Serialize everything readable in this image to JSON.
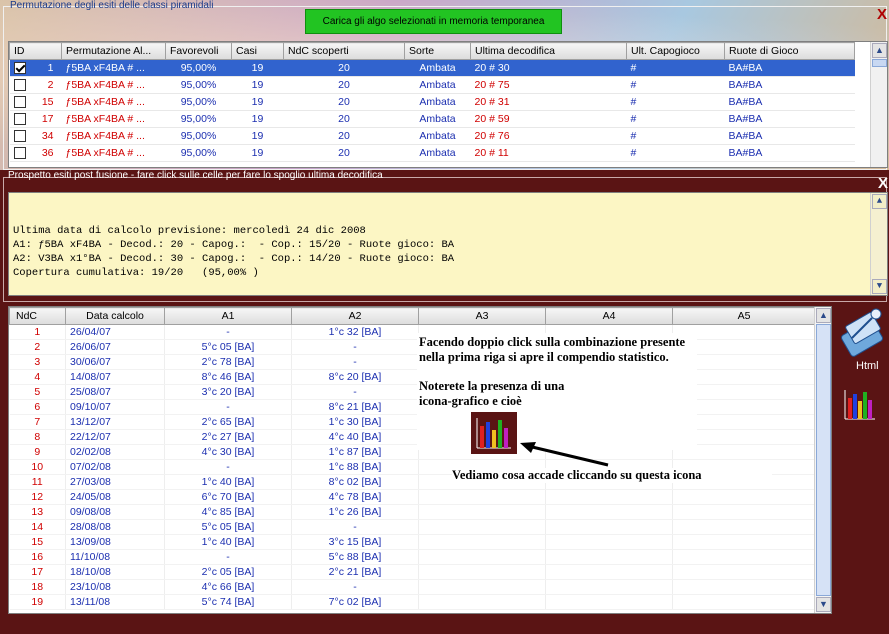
{
  "top_panel": {
    "group_title": "Permutazione degli esiti delle classi piramidali",
    "close_label": "X",
    "load_button_label": "Carica gli algo selezionati in memoria temporanea",
    "columns": [
      "ID",
      "Permutazione Al...",
      "Favorevoli",
      "Casi",
      "NdC scoperti",
      "Sorte",
      "Ultima decodifica",
      "Ult. Capogioco",
      "Ruote di Gioco"
    ],
    "rows": [
      {
        "checked": true,
        "id": "1",
        "perm": "ƒ5BA xF4BA # ...",
        "fav": "95,00%",
        "casi": "19",
        "ndc": "20",
        "sorte": "Ambata",
        "ultima": "20 # 30",
        "capogioco": "#",
        "ruote": "BA#BA"
      },
      {
        "checked": false,
        "id": "2",
        "perm": "ƒ5BA xF4BA # ...",
        "fav": "95,00%",
        "casi": "19",
        "ndc": "20",
        "sorte": "Ambata",
        "ultima": "20 # 75",
        "capogioco": "#",
        "ruote": "BA#BA"
      },
      {
        "checked": false,
        "id": "15",
        "perm": "ƒ5BA xF4BA # ...",
        "fav": "95,00%",
        "casi": "19",
        "ndc": "20",
        "sorte": "Ambata",
        "ultima": "20 # 31",
        "capogioco": "#",
        "ruote": "BA#BA"
      },
      {
        "checked": false,
        "id": "17",
        "perm": "ƒ5BA xF4BA # ...",
        "fav": "95,00%",
        "casi": "19",
        "ndc": "20",
        "sorte": "Ambata",
        "ultima": "20 # 59",
        "capogioco": "#",
        "ruote": "BA#BA"
      },
      {
        "checked": false,
        "id": "34",
        "perm": "ƒ5BA xF4BA # ...",
        "fav": "95,00%",
        "casi": "19",
        "ndc": "20",
        "sorte": "Ambata",
        "ultima": "20 # 76",
        "capogioco": "#",
        "ruote": "BA#BA"
      },
      {
        "checked": false,
        "id": "36",
        "perm": "ƒ5BA xF4BA # ...",
        "fav": "95,00%",
        "casi": "19",
        "ndc": "20",
        "sorte": "Ambata",
        "ultima": "20 # 11",
        "capogioco": "#",
        "ruote": "BA#BA"
      }
    ]
  },
  "mid_panel": {
    "title": "Prospetto esiti post fusione - fare click sulle celle per fare lo spoglio ultima decodifica",
    "close_label": "X",
    "memo_lines": [
      "Ultima data di calcolo previsione: mercoledì 24 dic 2008",
      "A1: ƒ5BA xF4BA - Decod.: 20 - Capog.:  - Cop.: 15/20 - Ruote gioco: BA",
      "A2: V3BA x1°BA - Decod.: 30 - Capog.:  - Cop.: 14/20 - Ruote gioco: BA",
      "Copertura cumulativa: 19/20   (95,00% )"
    ]
  },
  "results_grid": {
    "columns": [
      "NdC",
      "Data calcolo",
      "A1",
      "A2",
      "A3",
      "A4",
      "A5"
    ],
    "rows": [
      {
        "ndc": "1",
        "date": "26/04/07",
        "a1": "-",
        "a2": "1°c 32 [BA]"
      },
      {
        "ndc": "2",
        "date": "26/06/07",
        "a1": "5°c 05 [BA]",
        "a2": "-"
      },
      {
        "ndc": "3",
        "date": "30/06/07",
        "a1": "2°c 78 [BA]",
        "a2": "-"
      },
      {
        "ndc": "4",
        "date": "14/08/07",
        "a1": "8°c 46 [BA]",
        "a2": "8°c 20 [BA]"
      },
      {
        "ndc": "5",
        "date": "25/08/07",
        "a1": "3°c 20 [BA]",
        "a2": "-"
      },
      {
        "ndc": "6",
        "date": "09/10/07",
        "a1": "-",
        "a2": "8°c 21 [BA]"
      },
      {
        "ndc": "7",
        "date": "13/12/07",
        "a1": "2°c 65 [BA]",
        "a2": "1°c 30 [BA]"
      },
      {
        "ndc": "8",
        "date": "22/12/07",
        "a1": "2°c 27 [BA]",
        "a2": "4°c 40 [BA]"
      },
      {
        "ndc": "9",
        "date": "02/02/08",
        "a1": "4°c 30 [BA]",
        "a2": "1°c 87 [BA]"
      },
      {
        "ndc": "10",
        "date": "07/02/08",
        "a1": "-",
        "a2": "1°c 88 [BA]"
      },
      {
        "ndc": "11",
        "date": "27/03/08",
        "a1": "1°c 40 [BA]",
        "a2": "8°c 02 [BA]"
      },
      {
        "ndc": "12",
        "date": "24/05/08",
        "a1": "6°c 70 [BA]",
        "a2": "4°c 78 [BA]"
      },
      {
        "ndc": "13",
        "date": "09/08/08",
        "a1": "4°c 85 [BA]",
        "a2": "1°c 26 [BA]"
      },
      {
        "ndc": "14",
        "date": "28/08/08",
        "a1": "5°c 05 [BA]",
        "a2": "-"
      },
      {
        "ndc": "15",
        "date": "13/09/08",
        "a1": "1°c 40 [BA]",
        "a2": "3°c 15 [BA]"
      },
      {
        "ndc": "16",
        "date": "11/10/08",
        "a1": "-",
        "a2": "5°c 88 [BA]"
      },
      {
        "ndc": "17",
        "date": "18/10/08",
        "a1": "2°c 05 [BA]",
        "a2": "2°c 21 [BA]"
      },
      {
        "ndc": "18",
        "date": "23/10/08",
        "a1": "4°c 66 [BA]",
        "a2": "-"
      },
      {
        "ndc": "19",
        "date": "13/11/08",
        "a1": "5°c 74 [BA]",
        "a2": "7°c 02 [BA]"
      }
    ]
  },
  "side_tools": {
    "html_label": "Html",
    "html_icon": "html-export-icon",
    "chart_icon": "bar-chart-icon"
  },
  "annotation": {
    "paragraph1": "Facendo doppio click sulla combinazione presente nella prima riga si apre il compendio statistico.",
    "paragraph2": "Noterete la presenza di una icona-grafico e cioè",
    "caption": "Vediamo cosa accade cliccando su questa icona"
  },
  "colors": {
    "dark_panel": "#5a1414",
    "memo_bg": "#fcf6c4",
    "selection": "#3163ce",
    "load_button": "#22c422",
    "red_text": "#d00000",
    "blue_text": "#1c2fb0"
  }
}
